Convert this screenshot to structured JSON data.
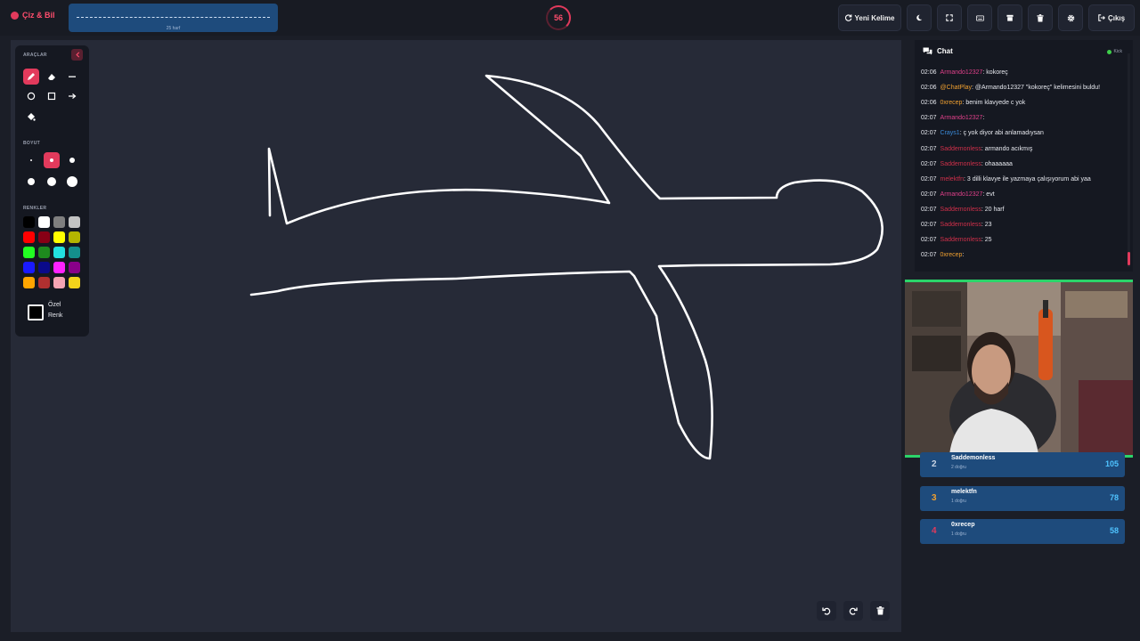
{
  "app": {
    "title": "Çiz & Bil"
  },
  "word": {
    "hint": "25 harf"
  },
  "timer": {
    "value": "56"
  },
  "toolbar": {
    "new_word_label": "Yeni Kelime",
    "logout_label": "Çıkış"
  },
  "tools_panel": {
    "tools_label": "ARAÇLAR",
    "size_label": "BOYUT",
    "colors_label": "RENKLER",
    "custom_color_line1": "Özel",
    "custom_color_line2": "Renk",
    "palette": [
      "#000000",
      "#ffffff",
      "#7f7f7f",
      "#c3c3c3",
      "#ff0000",
      "#880015",
      "#ffff00",
      "#b5b500",
      "#22ff22",
      "#1e8a1e",
      "#22e0e0",
      "#14908c",
      "#1a1aff",
      "#0a0a8a",
      "#ff22ff",
      "#880088",
      "#ffa500",
      "#b03030",
      "#f4a4b4",
      "#f2d31b"
    ]
  },
  "chat": {
    "title": "Chat",
    "platform": "Kick",
    "messages": [
      {
        "time": "02:06",
        "user": "Armando12327",
        "color": "#e0408a",
        "text": ": kokoreç"
      },
      {
        "time": "02:06",
        "user": "@ChatPlay",
        "color": "#f0a030",
        "text": ": @Armando12327 \"kokoreç\" kelimesini buldu!"
      },
      {
        "time": "02:06",
        "user": "0xrecep",
        "color": "#f0a030",
        "text": ": benim klavyede c yok"
      },
      {
        "time": "02:07",
        "user": "Armando12327",
        "color": "#e0408a",
        "text": ":"
      },
      {
        "time": "02:07",
        "user": "Crays1",
        "color": "#3a8ad8",
        "text": ": ç yok diyor abi anlamadıysan"
      },
      {
        "time": "02:07",
        "user": "Saddemonless",
        "color": "#d0304a",
        "text": ": armando acıkmış"
      },
      {
        "time": "02:07",
        "user": "Saddemonless",
        "color": "#d0304a",
        "text": ": ohaaaaaa"
      },
      {
        "time": "02:07",
        "user": "melektfn",
        "color": "#d0304a",
        "text": ": 3 dilli klavye ile yazmaya çalışıyorum abi yaa"
      },
      {
        "time": "02:07",
        "user": "Armando12327",
        "color": "#e0408a",
        "text": ": evt"
      },
      {
        "time": "02:07",
        "user": "Saddemonless",
        "color": "#d0304a",
        "text": ": 20 harf"
      },
      {
        "time": "02:07",
        "user": "Saddemonless",
        "color": "#d0304a",
        "text": ": 23"
      },
      {
        "time": "02:07",
        "user": "Saddemonless",
        "color": "#d0304a",
        "text": ": 25"
      },
      {
        "time": "02:07",
        "user": "0xrecep",
        "color": "#f0a030",
        "text": ":"
      }
    ]
  },
  "leaderboard": [
    {
      "rank": "2",
      "name": "Saddemonless",
      "sub": "2 doğru",
      "score": "105",
      "rank_color": "#c8d4e4"
    },
    {
      "rank": "3",
      "name": "melektfn",
      "sub": "1 doğru",
      "score": "78",
      "rank_color": "#f0a030"
    },
    {
      "rank": "4",
      "name": "0xrecep",
      "sub": "1 doğru",
      "score": "58",
      "rank_color": "#e23a5c"
    }
  ]
}
